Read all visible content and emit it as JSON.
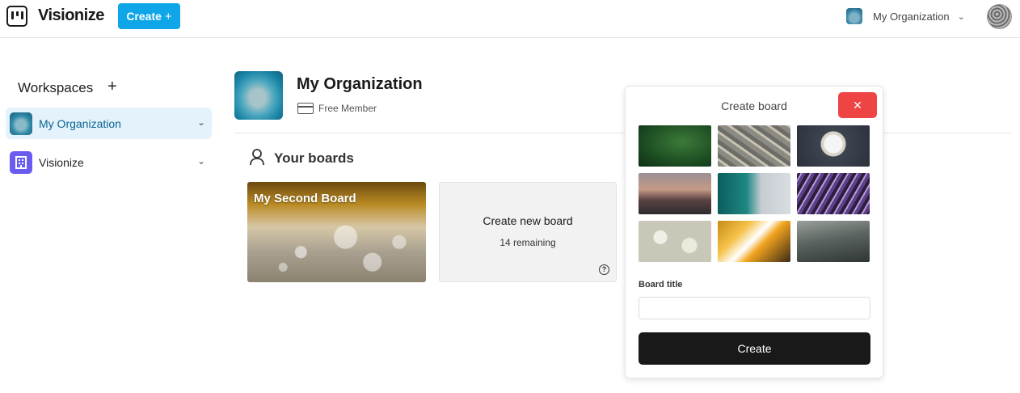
{
  "topbar": {
    "app_name": "Visionize",
    "create_label": "Create",
    "create_plus": "+",
    "org_name": "My Organization",
    "org_chevron": "⌄"
  },
  "sidebar": {
    "title": "Workspaces",
    "add_symbol": "+",
    "items": [
      {
        "label": "My Organization",
        "active": true
      },
      {
        "label": "Visionize",
        "active": false
      }
    ]
  },
  "org": {
    "name": "My Organization",
    "plan": "Free Member"
  },
  "boards": {
    "section_title": "Your boards",
    "items": [
      {
        "name": "My Second Board"
      }
    ],
    "new_board_label": "Create new board",
    "remaining": "14 remaining",
    "help_symbol": "?"
  },
  "popover": {
    "title": "Create board",
    "close_symbol": "✕",
    "board_title_label": "Board title",
    "board_title_value": "",
    "submit_label": "Create"
  },
  "colors": {
    "accent": "#0ea5e9",
    "close": "#ef4444",
    "submit": "#191919",
    "active_item_bg": "#e3f2fb",
    "workspace_icon": "#6a5cf0"
  }
}
